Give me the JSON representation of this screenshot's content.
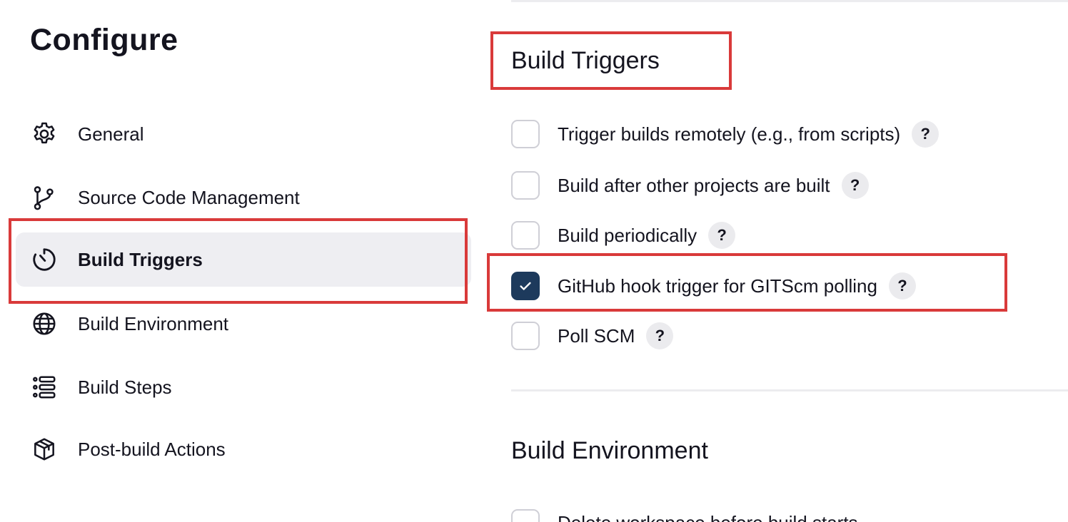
{
  "page": {
    "title": "Configure"
  },
  "sidebar": {
    "items": [
      {
        "label": "General",
        "icon": "gear-icon",
        "active": false
      },
      {
        "label": "Source Code Management",
        "icon": "git-branch-icon",
        "active": false
      },
      {
        "label": "Build Triggers",
        "icon": "timer-icon",
        "active": true
      },
      {
        "label": "Build Environment",
        "icon": "globe-icon",
        "active": false
      },
      {
        "label": "Build Steps",
        "icon": "list-icon",
        "active": false
      },
      {
        "label": "Post-build Actions",
        "icon": "package-icon",
        "active": false
      }
    ]
  },
  "main": {
    "build_triggers": {
      "title": "Build Triggers",
      "options": [
        {
          "label": "Trigger builds remotely (e.g., from scripts)",
          "checked": false,
          "help": "?"
        },
        {
          "label": "Build after other projects are built",
          "checked": false,
          "help": "?"
        },
        {
          "label": "Build periodically",
          "checked": false,
          "help": "?"
        },
        {
          "label": "GitHub hook trigger for GITScm polling",
          "checked": true,
          "help": "?"
        },
        {
          "label": "Poll SCM",
          "checked": false,
          "help": "?"
        }
      ]
    },
    "build_environment": {
      "title": "Build Environment",
      "partial_option_label": "Delete workspace before build starts"
    }
  },
  "colors": {
    "highlight": "#d93a3a",
    "checkbox_checked": "#1d3a5c",
    "active_sidebar_bg": "#eeeef2"
  }
}
